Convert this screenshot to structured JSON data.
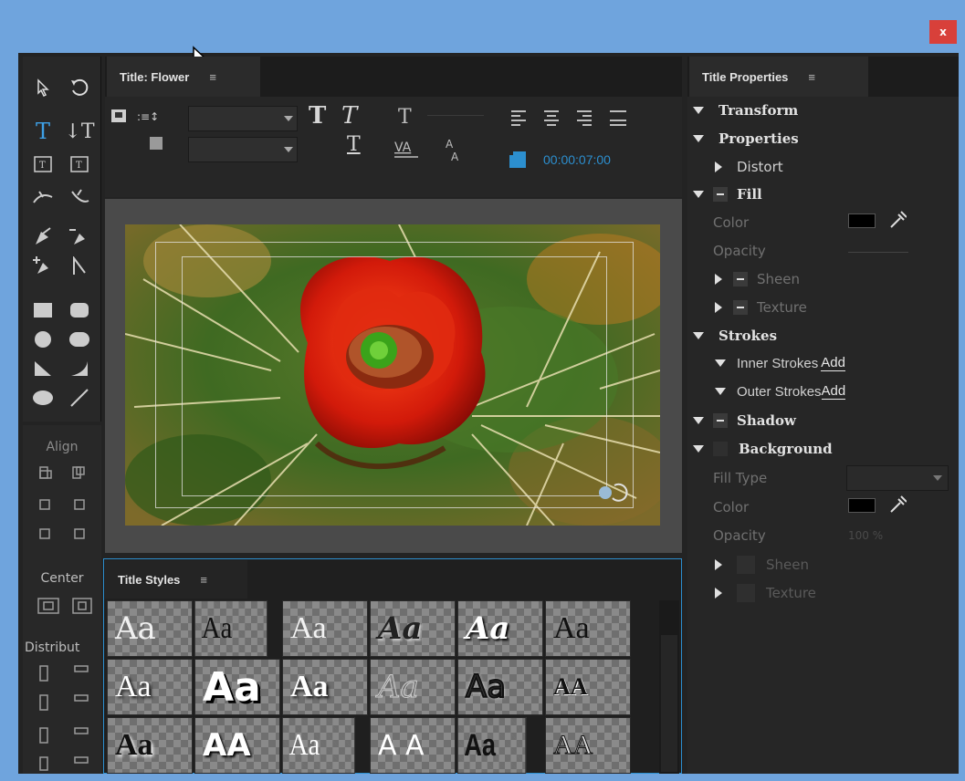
{
  "window": {
    "close_glyph": "x"
  },
  "title_panel": {
    "tab_label": "Title: Flower",
    "menu_glyph": "≡"
  },
  "toolbar": {
    "timecode": "00:00:07:00"
  },
  "align_panel": {
    "align_label": "Align",
    "center_label": "Center",
    "distribute_label": "Distribut"
  },
  "styles_panel": {
    "tab_label": "Title Styles",
    "menu_glyph": "≡",
    "swatches": [
      "Aa",
      "Aa",
      "Aa",
      "Aa",
      "Aa",
      "Aa",
      "Aa",
      "Aa",
      "Aa",
      "Aa",
      "Aa",
      "AA",
      "Aa",
      "AA",
      "Aa",
      "A A",
      "Aa",
      "AA"
    ]
  },
  "properties": {
    "tab_label": "Title Properties",
    "menu_glyph": "≡",
    "transform": "Transform",
    "properties": "Properties",
    "distort": "Distort",
    "fill": "Fill",
    "color": "Color",
    "opacity": "Opacity",
    "sheen": "Sheen",
    "texture": "Texture",
    "strokes": "Strokes",
    "inner_strokes": "Inner Strokes",
    "outer_strokes": "Outer Strokes",
    "add": "Add",
    "shadow": "Shadow",
    "background": "Background",
    "fill_type": "Fill Type",
    "bg_color": "Color",
    "bg_opacity": "Opacity",
    "bg_opacity_value": "100 %",
    "bg_sheen": "Sheen",
    "bg_texture": "Texture"
  },
  "colors": {
    "fill_color": "#000000",
    "bg_color": "#000000",
    "accent": "#2c8fcf"
  }
}
